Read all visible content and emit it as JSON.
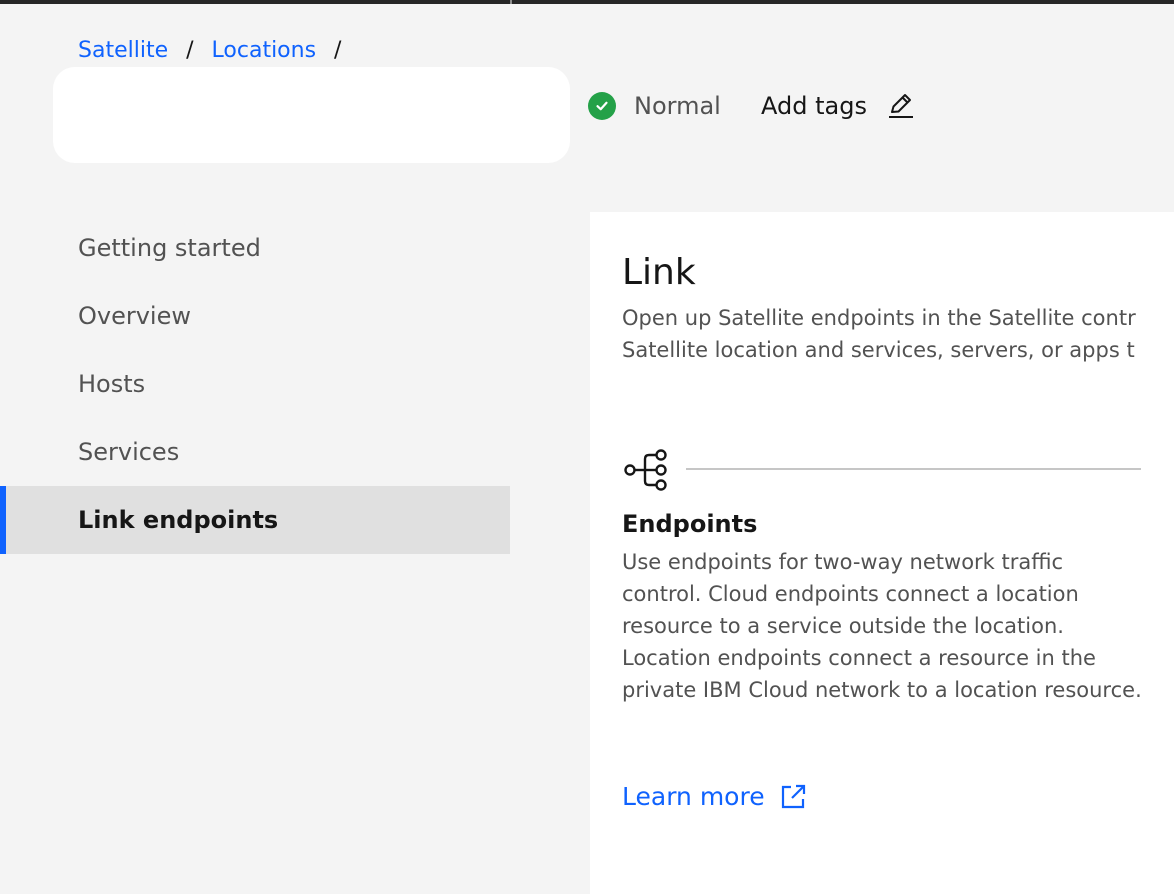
{
  "breadcrumb": {
    "items": [
      "Satellite",
      "Locations"
    ],
    "separator": "/"
  },
  "header": {
    "status": "Normal",
    "add_tags": "Add tags"
  },
  "sidebar": {
    "items": [
      {
        "label": "Getting started",
        "active": false
      },
      {
        "label": "Overview",
        "active": false
      },
      {
        "label": "Hosts",
        "active": false
      },
      {
        "label": "Services",
        "active": false
      },
      {
        "label": "Link endpoints",
        "active": true
      }
    ]
  },
  "main": {
    "title": "Link",
    "description_lines": [
      "Open up Satellite endpoints in the Satellite contr",
      "Satellite location and services, servers, or apps t"
    ],
    "endpoints": {
      "icon": "network-tree-icon",
      "title": "Endpoints",
      "description": "Use endpoints for two-way network traffic control. Cloud endpoints connect a location resource to a service outside the location. Location endpoints connect a resource in the private IBM Cloud network to a location resource.",
      "learn_more": "Learn more"
    }
  },
  "colors": {
    "link": "#0f62fe",
    "status_ok": "#24a148",
    "active_bg": "#e0e0e0"
  }
}
